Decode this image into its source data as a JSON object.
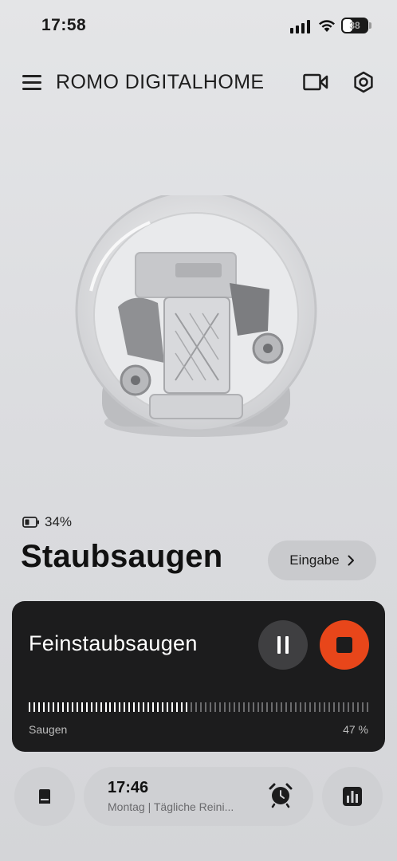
{
  "status_bar": {
    "time": "17:58",
    "battery": "38"
  },
  "header": {
    "brand": "ROMO DIGITALHOME",
    "menu_icon": "hamburger-menu-icon",
    "camera_icon": "video-camera-icon",
    "settings_icon": "hexagon-settings-icon"
  },
  "device": {
    "battery_percent": "34%",
    "mode_title": "Staubsaugen",
    "input_button": "Eingabe",
    "input_chevron": "›"
  },
  "cleaning_card": {
    "mode": "Feinstaubsaugen",
    "status_label": "Saugen",
    "progress_text": "47 %",
    "progress": 0.47,
    "colors": {
      "background": "#1c1c1d",
      "stop": "#e8461a",
      "tick_active": "#ffffff",
      "tick_inactive": "#6b6b6d"
    }
  },
  "bottom": {
    "schedule_time": "17:46",
    "schedule_subtitle": "Montag | Tägliche Reini...",
    "dock_icon": "dock-station-icon",
    "alarm_icon": "alarm-clock-icon",
    "stats_icon": "bar-chart-icon"
  }
}
